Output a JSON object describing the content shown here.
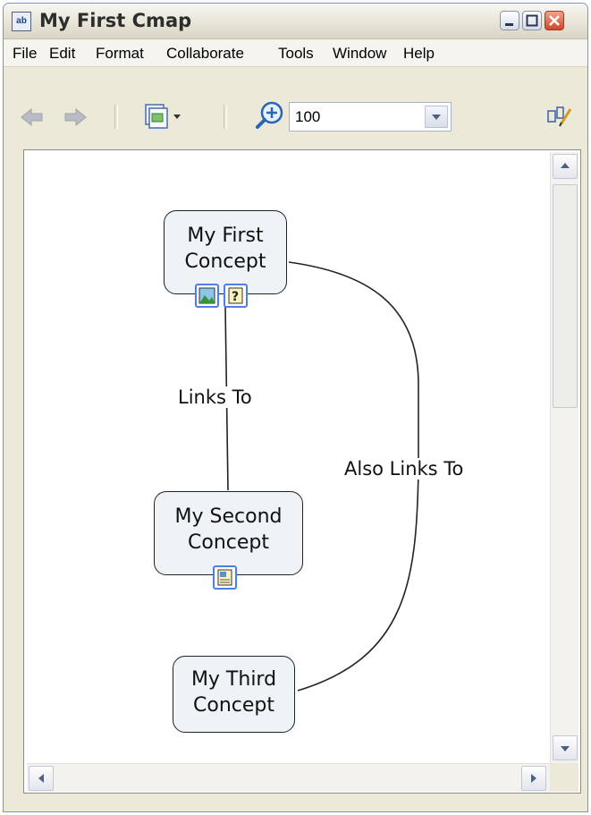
{
  "window": {
    "title": "My First Cmap"
  },
  "menu": [
    "File",
    "Edit",
    "Format",
    "Collaborate",
    "Tools",
    "Window",
    "Help"
  ],
  "toolbar": {
    "zoom_value": "100"
  },
  "concepts": {
    "first": [
      "My First",
      "Concept"
    ],
    "second": [
      "My Second",
      "Concept"
    ],
    "third": [
      "My Third",
      "Concept"
    ]
  },
  "links": {
    "links_to": "Links To",
    "also_links_to": "Also Links To"
  },
  "icons": {
    "app": "cmap-app-icon",
    "back": "back-arrow-icon",
    "forward": "forward-arrow-icon",
    "view": "view-options-icon",
    "zoom": "zoom-in-icon",
    "edit": "style-edit-icon",
    "image_resource": "image-resource-icon",
    "help_resource": "help-resource-icon",
    "doc_resource": "document-resource-icon"
  },
  "colors": {
    "concept_fill": "#edf3f6",
    "resource_border": "#4d7fe6",
    "close_button": "#d0462a"
  }
}
